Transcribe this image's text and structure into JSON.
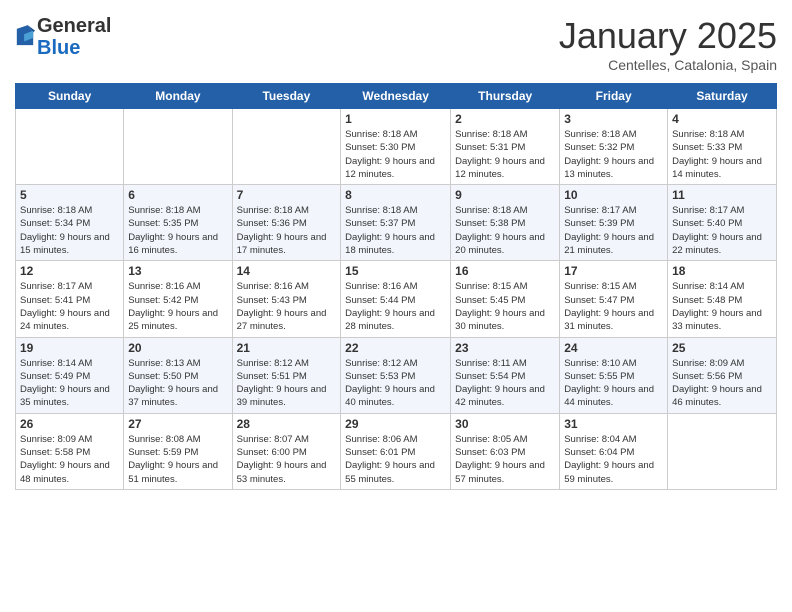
{
  "header": {
    "logo_line1": "General",
    "logo_line2": "Blue",
    "title": "January 2025",
    "location": "Centelles, Catalonia, Spain"
  },
  "days_of_week": [
    "Sunday",
    "Monday",
    "Tuesday",
    "Wednesday",
    "Thursday",
    "Friday",
    "Saturday"
  ],
  "weeks": [
    {
      "cells": [
        {
          "day": "",
          "content": ""
        },
        {
          "day": "",
          "content": ""
        },
        {
          "day": "",
          "content": ""
        },
        {
          "day": "1",
          "content": "Sunrise: 8:18 AM\nSunset: 5:30 PM\nDaylight: 9 hours and 12 minutes."
        },
        {
          "day": "2",
          "content": "Sunrise: 8:18 AM\nSunset: 5:31 PM\nDaylight: 9 hours and 12 minutes."
        },
        {
          "day": "3",
          "content": "Sunrise: 8:18 AM\nSunset: 5:32 PM\nDaylight: 9 hours and 13 minutes."
        },
        {
          "day": "4",
          "content": "Sunrise: 8:18 AM\nSunset: 5:33 PM\nDaylight: 9 hours and 14 minutes."
        }
      ]
    },
    {
      "cells": [
        {
          "day": "5",
          "content": "Sunrise: 8:18 AM\nSunset: 5:34 PM\nDaylight: 9 hours and 15 minutes."
        },
        {
          "day": "6",
          "content": "Sunrise: 8:18 AM\nSunset: 5:35 PM\nDaylight: 9 hours and 16 minutes."
        },
        {
          "day": "7",
          "content": "Sunrise: 8:18 AM\nSunset: 5:36 PM\nDaylight: 9 hours and 17 minutes."
        },
        {
          "day": "8",
          "content": "Sunrise: 8:18 AM\nSunset: 5:37 PM\nDaylight: 9 hours and 18 minutes."
        },
        {
          "day": "9",
          "content": "Sunrise: 8:18 AM\nSunset: 5:38 PM\nDaylight: 9 hours and 20 minutes."
        },
        {
          "day": "10",
          "content": "Sunrise: 8:17 AM\nSunset: 5:39 PM\nDaylight: 9 hours and 21 minutes."
        },
        {
          "day": "11",
          "content": "Sunrise: 8:17 AM\nSunset: 5:40 PM\nDaylight: 9 hours and 22 minutes."
        }
      ]
    },
    {
      "cells": [
        {
          "day": "12",
          "content": "Sunrise: 8:17 AM\nSunset: 5:41 PM\nDaylight: 9 hours and 24 minutes."
        },
        {
          "day": "13",
          "content": "Sunrise: 8:16 AM\nSunset: 5:42 PM\nDaylight: 9 hours and 25 minutes."
        },
        {
          "day": "14",
          "content": "Sunrise: 8:16 AM\nSunset: 5:43 PM\nDaylight: 9 hours and 27 minutes."
        },
        {
          "day": "15",
          "content": "Sunrise: 8:16 AM\nSunset: 5:44 PM\nDaylight: 9 hours and 28 minutes."
        },
        {
          "day": "16",
          "content": "Sunrise: 8:15 AM\nSunset: 5:45 PM\nDaylight: 9 hours and 30 minutes."
        },
        {
          "day": "17",
          "content": "Sunrise: 8:15 AM\nSunset: 5:47 PM\nDaylight: 9 hours and 31 minutes."
        },
        {
          "day": "18",
          "content": "Sunrise: 8:14 AM\nSunset: 5:48 PM\nDaylight: 9 hours and 33 minutes."
        }
      ]
    },
    {
      "cells": [
        {
          "day": "19",
          "content": "Sunrise: 8:14 AM\nSunset: 5:49 PM\nDaylight: 9 hours and 35 minutes."
        },
        {
          "day": "20",
          "content": "Sunrise: 8:13 AM\nSunset: 5:50 PM\nDaylight: 9 hours and 37 minutes."
        },
        {
          "day": "21",
          "content": "Sunrise: 8:12 AM\nSunset: 5:51 PM\nDaylight: 9 hours and 39 minutes."
        },
        {
          "day": "22",
          "content": "Sunrise: 8:12 AM\nSunset: 5:53 PM\nDaylight: 9 hours and 40 minutes."
        },
        {
          "day": "23",
          "content": "Sunrise: 8:11 AM\nSunset: 5:54 PM\nDaylight: 9 hours and 42 minutes."
        },
        {
          "day": "24",
          "content": "Sunrise: 8:10 AM\nSunset: 5:55 PM\nDaylight: 9 hours and 44 minutes."
        },
        {
          "day": "25",
          "content": "Sunrise: 8:09 AM\nSunset: 5:56 PM\nDaylight: 9 hours and 46 minutes."
        }
      ]
    },
    {
      "cells": [
        {
          "day": "26",
          "content": "Sunrise: 8:09 AM\nSunset: 5:58 PM\nDaylight: 9 hours and 48 minutes."
        },
        {
          "day": "27",
          "content": "Sunrise: 8:08 AM\nSunset: 5:59 PM\nDaylight: 9 hours and 51 minutes."
        },
        {
          "day": "28",
          "content": "Sunrise: 8:07 AM\nSunset: 6:00 PM\nDaylight: 9 hours and 53 minutes."
        },
        {
          "day": "29",
          "content": "Sunrise: 8:06 AM\nSunset: 6:01 PM\nDaylight: 9 hours and 55 minutes."
        },
        {
          "day": "30",
          "content": "Sunrise: 8:05 AM\nSunset: 6:03 PM\nDaylight: 9 hours and 57 minutes."
        },
        {
          "day": "31",
          "content": "Sunrise: 8:04 AM\nSunset: 6:04 PM\nDaylight: 9 hours and 59 minutes."
        },
        {
          "day": "",
          "content": ""
        }
      ]
    }
  ]
}
